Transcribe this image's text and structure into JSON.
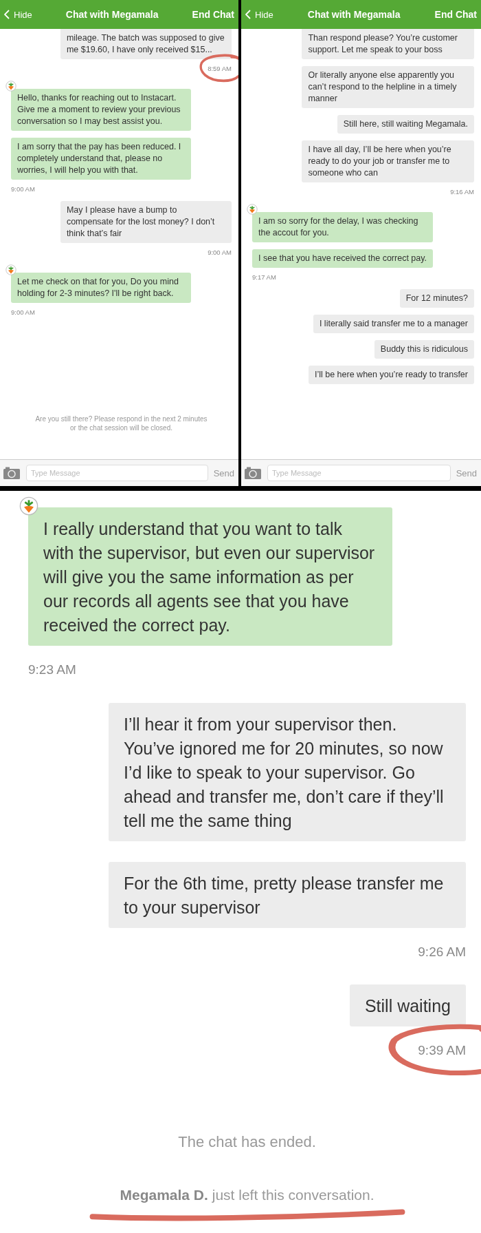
{
  "screens": [
    {
      "kind": "phone",
      "header": {
        "back": "Hide",
        "title": "Chat with Megamala",
        "action": "End Chat"
      },
      "messages": [
        {
          "kind": "user",
          "text": "mileage. The batch was supposed to give me $19.60, I have only received $15..."
        },
        {
          "kind": "sent_time",
          "text": "8:59 AM",
          "circled": true
        },
        {
          "kind": "agent",
          "avatar": true,
          "text": "Hello, thanks for reaching out to Instacart. Give me a moment to review your previous conversation so I may best assist you."
        },
        {
          "kind": "agent",
          "avatar": false,
          "text": "I am sorry that the pay has been reduced. I completely understand that, please no worries, I will help you with that."
        },
        {
          "kind": "received_time",
          "text": "9:00 AM",
          "circled": false
        },
        {
          "kind": "user",
          "text": "May I please have a bump to compensate for the lost money? I don’t think that’s fair"
        },
        {
          "kind": "sent_time",
          "text": "9:00 AM",
          "circled": false
        },
        {
          "kind": "agent",
          "avatar": true,
          "text": "Let me check on that for you, Do you mind holding for 2-3 minutes? I'll be right back."
        },
        {
          "kind": "received_time",
          "text": "9:00 AM",
          "circled": false
        },
        {
          "kind": "notice",
          "text": "Are you still there? Please respond in the next 2 minutes or the chat session will be closed."
        }
      ],
      "composer": {
        "placeholder": "Type Message",
        "send": "Send"
      }
    },
    {
      "kind": "phone",
      "header": {
        "back": "Hide",
        "title": "Chat with Megamala",
        "action": "End Chat"
      },
      "messages": [
        {
          "kind": "user",
          "text": "Than respond please? You’re customer support. Let me speak to your boss"
        },
        {
          "kind": "user",
          "text": "Or literally anyone else apparently you can’t respond to the helpline in a timely manner"
        },
        {
          "kind": "user",
          "text": "Still here, still waiting Megamala."
        },
        {
          "kind": "user",
          "text": "I have all day, I’ll be here when you’re ready to do your job or transfer me to someone who can"
        },
        {
          "kind": "sent_time",
          "text": "9:16 AM",
          "circled": false
        },
        {
          "kind": "agent",
          "avatar": true,
          "text": "I am so sorry for the delay, I was checking the accout for you."
        },
        {
          "kind": "agent",
          "avatar": false,
          "text": "I see that you have received the correct pay."
        },
        {
          "kind": "received_time",
          "text": "9:17 AM",
          "circled": false
        },
        {
          "kind": "user",
          "text": "For 12 minutes?"
        },
        {
          "kind": "user",
          "text": "I literally said transfer me to a manager"
        },
        {
          "kind": "user",
          "text": "Buddy this is ridiculous"
        },
        {
          "kind": "user",
          "text": "I’ll be here when you’re ready to transfer"
        }
      ],
      "composer": {
        "placeholder": "Type Message",
        "send": "Send"
      }
    },
    {
      "kind": "zoomed",
      "messages": [
        {
          "kind": "agent",
          "avatar": true,
          "text": "I really understand that you want to talk with the supervisor, but even our supervisor will give you the same information as per our records all agents see that you have received the correct pay."
        },
        {
          "kind": "received_time",
          "text": "9:23 AM",
          "circled": false
        },
        {
          "kind": "user",
          "text": "I’ll hear it from your supervisor then. You’ve ignored me for 20 minutes, so now I’d like to speak to your supervisor. Go ahead and transfer me, don’t care if they’ll tell me the same thing"
        },
        {
          "kind": "user",
          "text": "For the 6th time, pretty please transfer me to your supervisor"
        },
        {
          "kind": "sent_time",
          "text": "9:26 AM",
          "circled": false
        },
        {
          "kind": "user",
          "text": "Still waiting"
        },
        {
          "kind": "sent_time",
          "text": "9:39 AM",
          "circled": true
        },
        {
          "kind": "notice",
          "text": "The chat has ended."
        },
        {
          "kind": "left",
          "text": "**Megamala D.** just left this conversation.",
          "underlined": true
        }
      ]
    }
  ]
}
